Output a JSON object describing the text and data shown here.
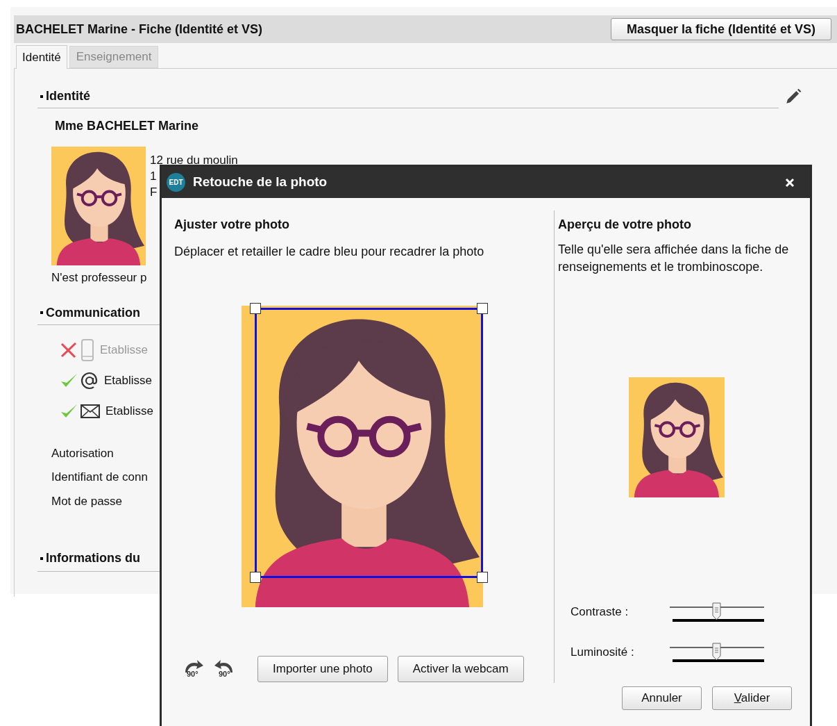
{
  "window": {
    "title": "BACHELET Marine - Fiche (Identité et VS)",
    "hide_button": "Masquer la fiche (Identité et VS)"
  },
  "tabs": [
    {
      "label": "Identité",
      "selected": true
    },
    {
      "label": "Enseignement",
      "selected": false
    }
  ],
  "identity": {
    "heading": "Identité",
    "name": "Mme BACHELET Marine",
    "address_lines": [
      "12 rue du moulin",
      "1",
      "F"
    ],
    "note": "N'est professeur p"
  },
  "communication": {
    "heading": "Communication",
    "items": [
      {
        "kind": "phone",
        "allowed": false,
        "label": "Etablisse"
      },
      {
        "kind": "email",
        "allowed": true,
        "label": "Etablisse"
      },
      {
        "kind": "mail",
        "allowed": true,
        "label": "Etablisse"
      }
    ]
  },
  "fields": [
    "Autorisation",
    "Identifiant de conn",
    "Mot de passe"
  ],
  "info": {
    "heading": "Informations du"
  },
  "dialog": {
    "title": "Retouche de la photo",
    "logo": "EDT",
    "left": {
      "heading": "Ajuster votre photo",
      "hint": "Déplacer et retailler le cadre bleu pour recadrer la photo"
    },
    "rotate": [
      {
        "label": "90°",
        "kind": "clockwise"
      },
      {
        "label": "90°",
        "kind": "counterclockwise"
      }
    ],
    "buttons": [
      "Importer une photo",
      "Activer la webcam"
    ],
    "right": {
      "heading": "Aperçu de votre photo",
      "hint": "Telle qu'elle sera affichée dans la fiche de renseignements et le trombinoscope."
    },
    "sliders": [
      {
        "label": "Contraste :",
        "level": 0.49
      },
      {
        "label": "Luminosité :",
        "level": 0.49
      }
    ],
    "actions": [
      {
        "label": "Annuler",
        "access_key": false
      },
      {
        "label": "Valider",
        "access_key": true
      }
    ]
  }
}
